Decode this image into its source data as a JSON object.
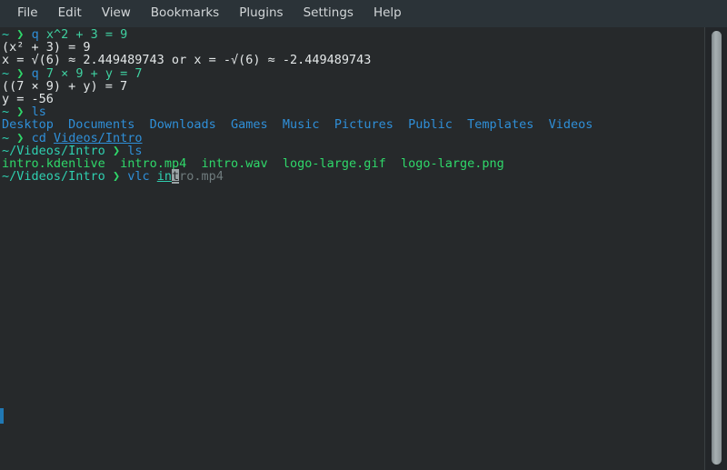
{
  "window": {
    "background_color": "#26292b",
    "menubar_color": "#2b3338"
  },
  "menubar": {
    "items": [
      {
        "label": "File"
      },
      {
        "label": "Edit"
      },
      {
        "label": "View"
      },
      {
        "label": "Bookmarks"
      },
      {
        "label": "Plugins"
      },
      {
        "label": "Settings"
      },
      {
        "label": "Help"
      }
    ]
  },
  "terminal": {
    "prompt_home": "~",
    "prompt_chevron": "❯",
    "prompt_path": "~/Videos/Intro",
    "lines": {
      "l1_cmd": "q",
      "l1_expr": " x^2 + 3 = 9",
      "l2": "(x² + 3) = 9",
      "l3": "x = √(6) ≈ 2.449489743 or x = -√(6) ≈ -2.449489743",
      "l4_cmd": "q",
      "l4_expr": " 7 × 9 + y = 7",
      "l5": "((7 × 9) + y) = 7",
      "l6": "y = -56",
      "l7_cmd": "ls",
      "l8_dirs": [
        "Desktop",
        "Documents",
        "Downloads",
        "Games",
        "Music",
        "Pictures",
        "Public",
        "Templates",
        "Videos"
      ],
      "l9_cmd": "cd",
      "l9_arg": "Videos/Intro",
      "l10_cmd": "ls",
      "l11_files": [
        "intro.kdenlive",
        "intro.mp4",
        "intro.wav",
        "logo-large.gif",
        "logo-large.png"
      ],
      "l12_cmd": "vlc",
      "l12_typed": "in",
      "l12_cursor_char": "t",
      "l12_suggestion": "ro.mp4"
    },
    "colors": {
      "prompt_home": "#2fd0b0",
      "prompt_chevron": "#2fd86a",
      "command": "#2f8fd8",
      "expression": "#3fd0a0",
      "output": "#e3e7e8",
      "directory": "#2f8fd8",
      "file": "#2fd86a",
      "suggestion": "#6f7b7d",
      "cursor_block": "#9aa3a5",
      "marker": "#2078b4"
    }
  },
  "scrollbar": {
    "thumb_color": "#a8b0b2"
  }
}
